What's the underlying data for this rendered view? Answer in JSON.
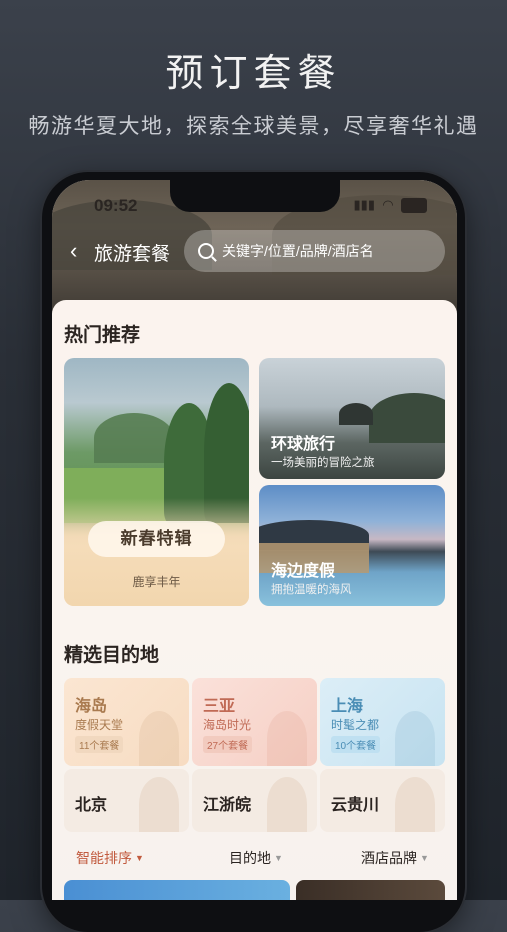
{
  "hero": {
    "title": "预订套餐",
    "subtitle": "畅游华夏大地，探索全球美景，尽享奢华礼遇"
  },
  "status_bar": {
    "time": "09:52"
  },
  "nav": {
    "back_icon": "chevron-left-icon",
    "title": "旅游套餐",
    "search_placeholder": "关键字/位置/品牌/酒店名"
  },
  "hot": {
    "title": "热门推荐",
    "big_card": {
      "badge": "新春特辑",
      "caption": "鹿享丰年"
    },
    "cards": [
      {
        "title": "环球旅行",
        "desc": "一场美丽的冒险之旅"
      },
      {
        "title": "海边度假",
        "desc": "拥抱温暖的海风"
      }
    ]
  },
  "destinations": {
    "title": "精选目的地",
    "featured": [
      {
        "name": "海岛",
        "sub": "度假天堂",
        "count": "11个套餐"
      },
      {
        "name": "三亚",
        "sub": "海岛时光",
        "count": "27个套餐"
      },
      {
        "name": "上海",
        "sub": "时髦之都",
        "count": "10个套餐"
      }
    ],
    "others": [
      {
        "name": "北京"
      },
      {
        "name": "江浙皖"
      },
      {
        "name": "云贵川"
      }
    ]
  },
  "filters": [
    {
      "label": "智能排序",
      "active": true
    },
    {
      "label": "目的地",
      "active": false
    },
    {
      "label": "酒店品牌",
      "active": false
    }
  ],
  "colors": {
    "accent": "#c25b3f",
    "background": "#2a2f37"
  }
}
